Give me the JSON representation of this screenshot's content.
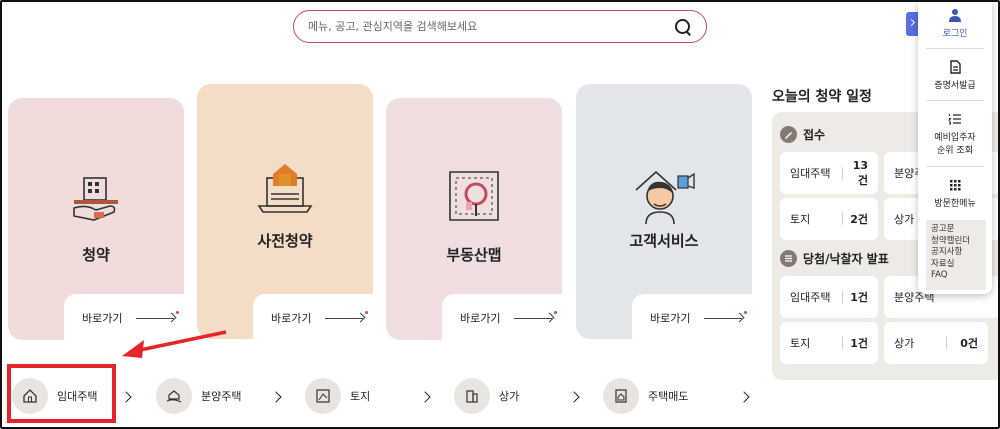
{
  "search": {
    "placeholder": "메뉴, 공고, 관심지역을 검색해보세요"
  },
  "colors": {
    "accent": "#c64b5f",
    "highlight": "#e4262a",
    "side_tab": "#5a6ee0"
  },
  "cards": [
    {
      "title": "청약",
      "go_label": "바로가기",
      "bg": "#f0dcdb",
      "icon": "house-hand-icon"
    },
    {
      "title": "사전청약",
      "go_label": "바로가기",
      "bg": "#f3ddc6",
      "icon": "laptop-house-icon"
    },
    {
      "title": "부동산맵",
      "go_label": "바로가기",
      "bg": "#f0dfe0",
      "icon": "map-magnifier-icon"
    },
    {
      "title": "고객서비스",
      "go_label": "바로가기",
      "bg": "#e2e6ea",
      "icon": "person-thumbsup-icon"
    }
  ],
  "quick_nav": [
    {
      "label": "임대주택",
      "icon": "house-icon"
    },
    {
      "label": "분양주택",
      "icon": "house-hand-icon"
    },
    {
      "label": "토지",
      "icon": "land-map-icon"
    },
    {
      "label": "상가",
      "icon": "building-icon"
    },
    {
      "label": "주택매도",
      "icon": "document-house-icon"
    }
  ],
  "schedule": {
    "title": "오늘의 청약 일정",
    "reception": {
      "label": "접수",
      "items": [
        {
          "name": "임대주택",
          "count": "13건"
        },
        {
          "name": "분양주택",
          "count": ""
        },
        {
          "name": "토지",
          "count": "2건"
        },
        {
          "name": "상가",
          "count": ""
        }
      ]
    },
    "winners": {
      "label": "당첨/낙찰자 발표",
      "items": [
        {
          "name": "임대주택",
          "count": "1건"
        },
        {
          "name": "분양주택",
          "count": ""
        },
        {
          "name": "토지",
          "count": "1건"
        },
        {
          "name": "상가",
          "count": "0건"
        }
      ]
    }
  },
  "side_panel": {
    "login": "로그인",
    "certificate": "증명서발급",
    "waitlist_line1": "예비입주자",
    "waitlist_line2": "순위 조회",
    "all_menu": "방문한메뉴",
    "links": [
      "공고문",
      "청약캘린더",
      "공지사항",
      "자료실",
      "FAQ"
    ]
  }
}
